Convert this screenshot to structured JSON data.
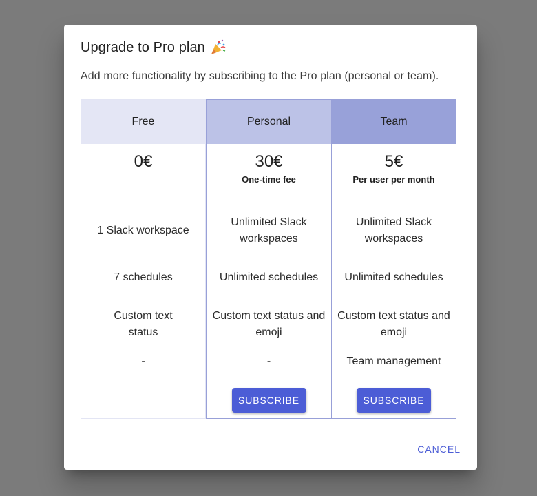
{
  "dialog": {
    "title": "Upgrade to Pro plan",
    "title_icon": "party-popper-icon",
    "subtitle": "Add more functionality by subscribing to the Pro plan (personal or team).",
    "cancel_label": "CANCEL"
  },
  "plans": [
    {
      "name": "Free",
      "price": "0€",
      "price_note": "",
      "features": [
        "1 Slack workspace",
        "7 schedules",
        "Custom text status",
        "-"
      ],
      "subscribe_label": ""
    },
    {
      "name": "Personal",
      "price": "30€",
      "price_note": "One-time fee",
      "features": [
        "Unlimited Slack workspaces",
        "Unlimited schedules",
        "Custom text status and emoji",
        "-"
      ],
      "subscribe_label": "SUBSCRIBE"
    },
    {
      "name": "Team",
      "price": "5€",
      "price_note": "Per user per month",
      "features": [
        "Unlimited Slack workspaces",
        "Unlimited schedules",
        "Custom text status and emoji",
        "Team management"
      ],
      "subscribe_label": "SUBSCRIBE"
    }
  ],
  "colors": {
    "accent": "#4c5dd6",
    "free_header": "#e4e6f5",
    "personal_header": "#bcc2e7",
    "team_header": "#98a1d9",
    "backdrop": "#7b7b7b"
  }
}
